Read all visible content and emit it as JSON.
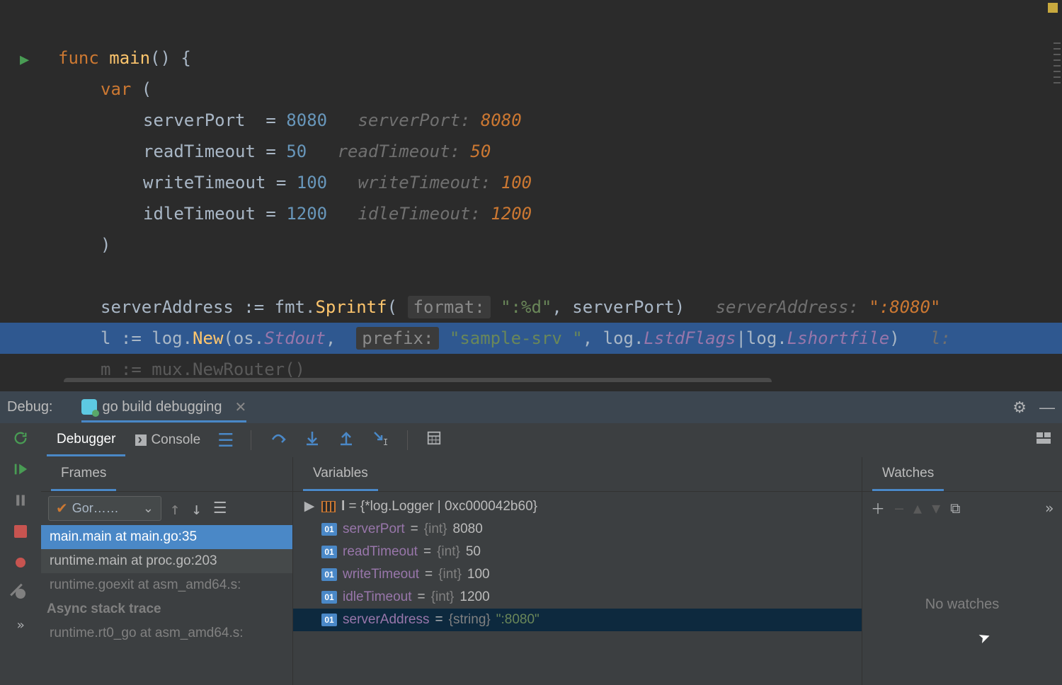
{
  "code": {
    "func_kw": "func",
    "main_fn": "main",
    "func_sig": "() {",
    "var_kw": "var",
    "open_paren": " (",
    "close_paren": ")",
    "vars": [
      {
        "name": "serverPort",
        "eq": "  = ",
        "val": "8080",
        "hint_n": "serverPort: ",
        "hint_v": "8080"
      },
      {
        "name": "readTimeout",
        "eq": " = ",
        "val": "50",
        "hint_n": "readTimeout: ",
        "hint_v": "50"
      },
      {
        "name": "writeTimeout",
        "eq": "= ",
        "val": "100",
        "hint_n": "writeTimeout: ",
        "hint_v": "100"
      },
      {
        "name": "idleTimeout",
        "eq": " = ",
        "val": "1200",
        "hint_n": "idleTimeout: ",
        "hint_v": "1200"
      }
    ],
    "addr_line": {
      "pre": "serverAddress := fmt.",
      "fn": "Sprintf",
      "open": "( ",
      "ph": "format:",
      "str": "\":%d\"",
      "rest": ", serverPort)",
      "hint_n": "serverAddress: ",
      "hint_v": "\":8080\""
    },
    "exec_line": {
      "v": "l",
      "op": " := ",
      "pkg": "log.",
      "fn": "New",
      "a1": "(os.",
      "std": "Stdout",
      ", ": ", ",
      "ph": "prefix:",
      "str": "\"sample-srv \"",
      "c": ", ",
      "p2": "log.",
      "c1": "LstdFlags",
      "pipe": "|",
      "p3": "log.",
      "c2": "Lshortfile",
      "close": ")",
      "hint": "l:"
    },
    "next_line": {
      "v": "m",
      "op": " := ",
      "pkg": "mux.",
      "fn": "NewRouter",
      "rest": "()"
    }
  },
  "debug": {
    "label": "Debug:",
    "tab_name": "go build debugging",
    "inner_tabs": {
      "debugger": "Debugger",
      "console": "Console"
    },
    "frames": {
      "title": "Frames",
      "combo": "Gor……",
      "rows": [
        "main.main at main.go:35",
        "runtime.main at proc.go:203",
        "runtime.goexit at asm_amd64.s:"
      ],
      "async": "Async stack trace",
      "rows2": [
        "runtime.rt0_go at asm_amd64.s:"
      ]
    },
    "variables": {
      "title": "Variables",
      "obj": {
        "name": "l",
        "val": " = {*log.Logger | 0xc000042b60}"
      },
      "items": [
        {
          "name": "serverPort",
          "type": "{int}",
          "val": "8080"
        },
        {
          "name": "readTimeout",
          "type": "{int}",
          "val": "50"
        },
        {
          "name": "writeTimeout",
          "type": "{int}",
          "val": "100"
        },
        {
          "name": "idleTimeout",
          "type": "{int}",
          "val": "1200"
        },
        {
          "name": "serverAddress",
          "type": "{string}",
          "val": "\":8080\"",
          "str": true
        }
      ]
    },
    "watches": {
      "title": "Watches",
      "empty": "No watches"
    }
  }
}
